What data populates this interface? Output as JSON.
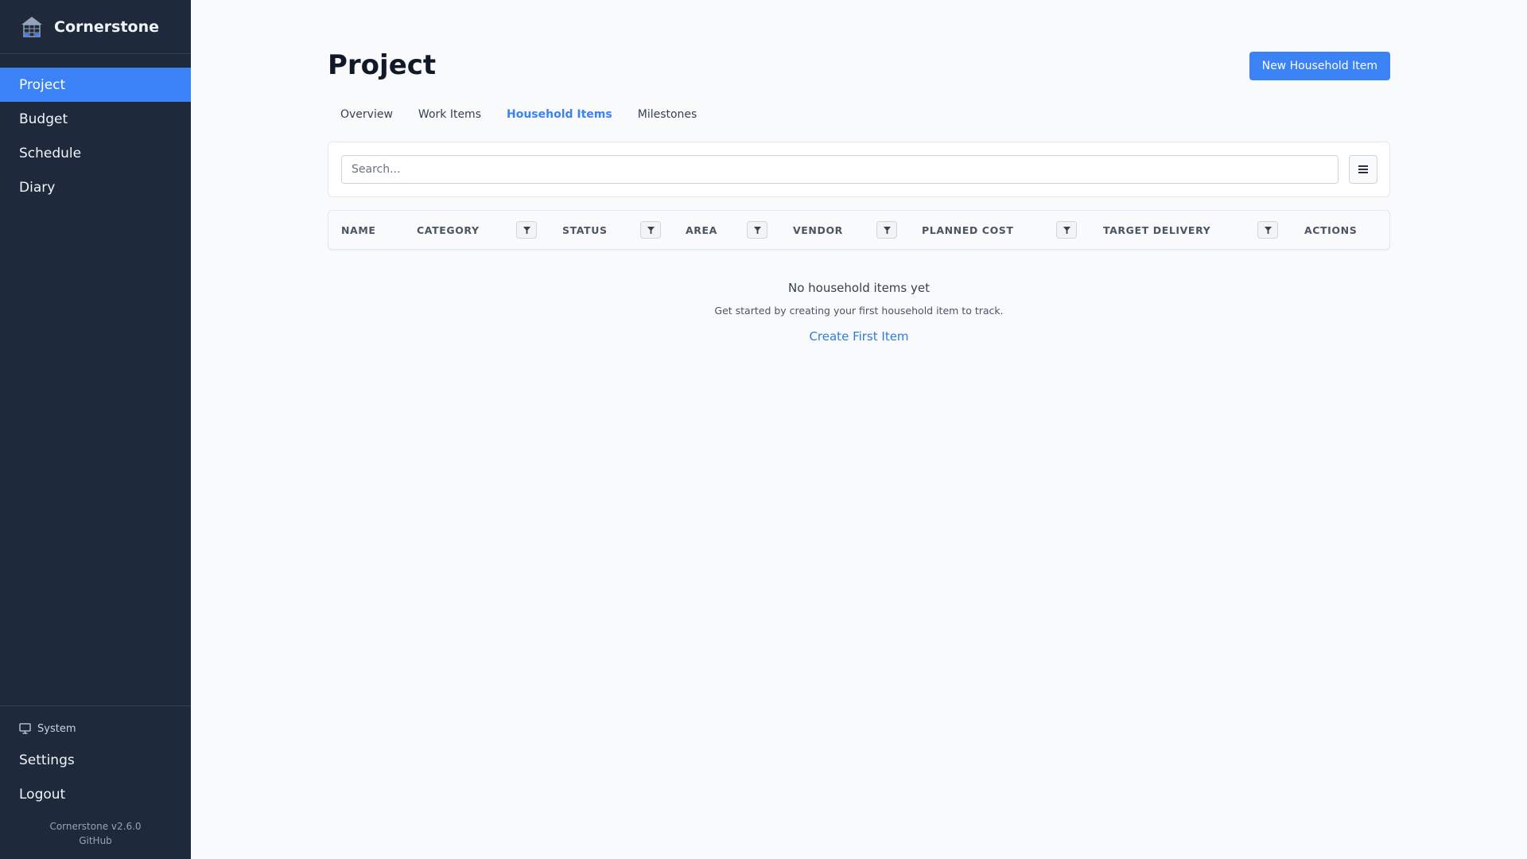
{
  "sidebar": {
    "brand": "Cornerstone",
    "nav": [
      {
        "label": "Project",
        "active": true
      },
      {
        "label": "Budget",
        "active": false
      },
      {
        "label": "Schedule",
        "active": false
      },
      {
        "label": "Diary",
        "active": false
      }
    ],
    "theme_label": "System",
    "footer": {
      "settings": "Settings",
      "logout": "Logout"
    },
    "version": "Cornerstone v2.6.0",
    "github": "GitHub"
  },
  "header": {
    "title": "Project",
    "new_button": "New Household Item"
  },
  "tabs": [
    {
      "label": "Overview",
      "active": false
    },
    {
      "label": "Work Items",
      "active": false
    },
    {
      "label": "Household Items",
      "active": true
    },
    {
      "label": "Milestones",
      "active": false
    }
  ],
  "search": {
    "placeholder": "Search...",
    "value": ""
  },
  "table": {
    "columns": [
      "NAME",
      "CATEGORY",
      "STATUS",
      "AREA",
      "VENDOR",
      "PLANNED COST",
      "TARGET DELIVERY",
      "ACTIONS"
    ]
  },
  "empty_state": {
    "title": "No household items yet",
    "text": "Get started by creating your first household item to track.",
    "link": "Create First Item"
  },
  "icons": {
    "logo": "house-building-icon",
    "theme": "monitor-icon",
    "columns": "menu-icon",
    "filter": "filter-icon"
  },
  "colors": {
    "sidebar_bg": "#1e293b",
    "accent": "#3b82f6",
    "page_bg": "#f8fafc"
  }
}
